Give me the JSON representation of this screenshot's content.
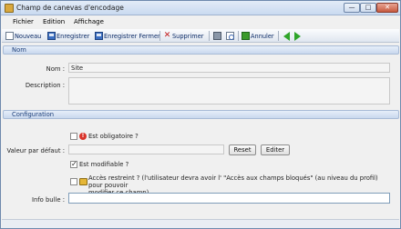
{
  "window": {
    "title": "Champ de canevas d'encodage",
    "min_glyph": "—",
    "max_glyph": "□",
    "close_glyph": "✕"
  },
  "menu": {
    "items": [
      "Fichier",
      "Edition",
      "Affichage"
    ]
  },
  "toolbar": {
    "nouveau": "Nouveau",
    "enregistrer": "Enregistrer",
    "enregistrer_fermer": "Enregistrer Fermer",
    "supprimer": "Supprimer",
    "annuler": "Annuler",
    "icons": [
      "new-doc-icon",
      "save-icon",
      "save-close-icon",
      "delete-icon",
      "print-icon",
      "print-preview-icon",
      "undo-icon",
      "back-arrow-icon",
      "forward-arrow-icon"
    ]
  },
  "sections": {
    "nom_header": "Nom",
    "config_header": "Configuration"
  },
  "nom": {
    "nom_label": "Nom :",
    "nom_value": "Site",
    "description_label": "Description :",
    "description_value": ""
  },
  "config": {
    "obligatoire_label": "Est obligatoire ?",
    "obligatoire_checked": false,
    "valeur_label": "Valeur par défaut :",
    "valeur_value": "",
    "reset_button": "Reset",
    "editer_button": "Editer",
    "modifiable_label": "Est modifiable ?",
    "modifiable_checked": true,
    "acces_label_line1": "Accès restreint ? (l'utilisateur devra avoir l' \"Accès aux champs bloqués\" (au niveau du profil) pour pouvoir",
    "acces_label_line2": "modifier ce champ)",
    "acces_checked": false,
    "info_label": "Info bulle :",
    "info_value": ""
  }
}
